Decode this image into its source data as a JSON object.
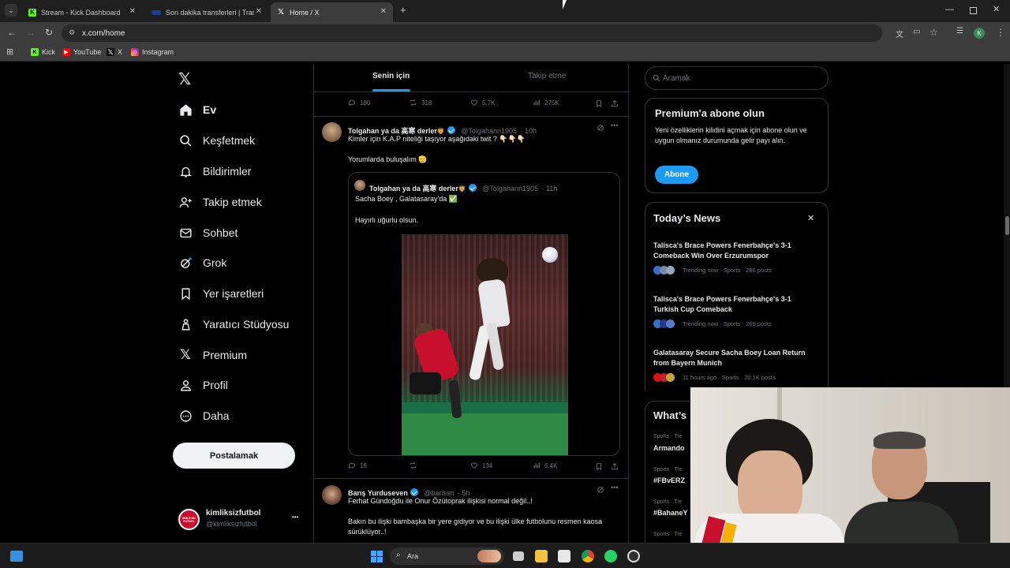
{
  "browser": {
    "tabs": [
      {
        "title": "Stream - Kick Dashboard",
        "favicon": "kick-icon",
        "color": "#53fc18"
      },
      {
        "title": "Son dakika transferleri | Transfe",
        "favicon": "transfermarkt-icon",
        "color": "#1a3d8f"
      },
      {
        "title": "Home / X",
        "favicon": "x-icon",
        "color": "#000000"
      }
    ],
    "new_tab": "+",
    "url": "x.com/home",
    "profile_initial": "K",
    "bookmarks": [
      {
        "label": "Kick",
        "icon": "kick-icon"
      },
      {
        "label": "YouTube",
        "icon": "youtube-icon"
      },
      {
        "label": "X",
        "icon": "x-icon"
      },
      {
        "label": "Instagram",
        "icon": "instagram-icon"
      }
    ]
  },
  "nav": {
    "items": [
      {
        "label": "Ev",
        "icon": "home-icon"
      },
      {
        "label": "Keşfetmek",
        "icon": "search-icon"
      },
      {
        "label": "Bildirimler",
        "icon": "bell-icon"
      },
      {
        "label": "Takip etmek",
        "icon": "add-user-icon"
      },
      {
        "label": "Sohbet",
        "icon": "mail-icon"
      },
      {
        "label": "Grok",
        "icon": "grok-icon"
      },
      {
        "label": "Yer işaretleri",
        "icon": "bookmark-icon"
      },
      {
        "label": "Yaratıcı Stüdyosu",
        "icon": "creator-icon"
      },
      {
        "label": "Premium",
        "icon": "x-icon"
      },
      {
        "label": "Profil",
        "icon": "person-icon"
      },
      {
        "label": "Daha",
        "icon": "more-circle-icon"
      }
    ],
    "post_button": "Postalamak",
    "account": {
      "name": "kimliksizfutbol",
      "handle": "@kimliksizfutbol",
      "more": "•••",
      "avatar_text": "KİMLİKSİZ FUTBOL"
    }
  },
  "feed": {
    "tabs": [
      "Senin için",
      "Takip etme"
    ],
    "top_actions": {
      "replies": "190",
      "reposts": "318",
      "likes": "5.7K",
      "views": "275K"
    },
    "tweet1": {
      "name": "Tolgahan ya da 高寒 derler",
      "handle": "@Tolgahann1905",
      "time": "· 10h",
      "text1": "Kimler için K.A.P niteliği taşıyor aşağıdaki twit ? 👇🏻👇🏻👇🏻",
      "text2": "Yorumlarda buluşalım 🫡",
      "quote": {
        "name": "Tolgahan ya da 高寒 derler",
        "handle": "@Tolgahann1905",
        "time": "· 11h",
        "text1": "Sacha Boey , Galatasaray'da ✅",
        "text2": "Hayırlı uğurlu olsun."
      },
      "actions": {
        "replies": "18",
        "reposts": "",
        "likes": "134",
        "views": "6.4K"
      }
    },
    "tweet2": {
      "name": "Barış Yurduseven",
      "handle": "@barissn",
      "time": "· 5h",
      "text1": "Ferhat Gündoğdu ile Onur Özütoprak ilişkisi normal değil..!",
      "text2": "Bakın bu ilişki bambaşka bir yere gidiyor ve bu ilişki ülke futbolunu resmen kaosa sürüklüyor..!"
    }
  },
  "sidebar": {
    "search_placeholder": "Aramak",
    "premium": {
      "title": "Premium'a abone olun",
      "body": "Yeni özelliklerin kilidini açmak için abone olun ve uygun olmanız durumunda gelir payı alın.",
      "button": "Abone"
    },
    "news": {
      "title": "Today’s News",
      "close": "✕",
      "items": [
        {
          "headline": "Talisca's Brace Powers Fenerbahçe's 3-1 Comeback Win Over Erzurumspor",
          "meta": "Trending now · Sports · 286 posts"
        },
        {
          "headline": "Talisca's Brace Powers Fenerbahçe's 3-1 Turkish Cup Comeback",
          "meta": "Trending now · Sports · 269 posts"
        },
        {
          "headline": "Galatasaray Secure Sacha Boey Loan Return from Bayern Munich",
          "meta": "11 hours ago · Sports · 20.1K posts"
        }
      ]
    },
    "trends": {
      "title": "What’s",
      "items": [
        {
          "cat": "Sports · Tre",
          "name": "Armando"
        },
        {
          "cat": "Sports · Tre",
          "name": "#FBvERZ"
        },
        {
          "cat": "Sports · Tre",
          "name": "#BahaneY"
        },
        {
          "cat": "Sports · Tre",
          "name": ""
        }
      ]
    }
  },
  "taskbar": {
    "search_label": "Ara"
  },
  "colors": {
    "accent": "#1d9bf0",
    "bg": "#000000",
    "border": "#2f3336",
    "muted": "#71767b"
  }
}
